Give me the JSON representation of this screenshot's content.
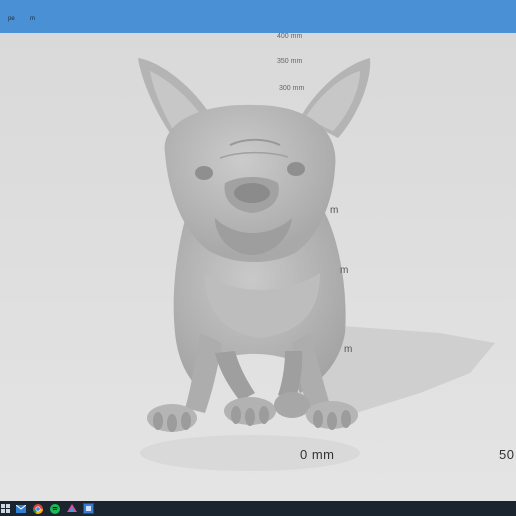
{
  "menu": {
    "items": [
      "pe",
      "m"
    ]
  },
  "viewport": {
    "ruler_far": [
      "400 mm",
      "350 mm",
      "300 mm"
    ],
    "ruler_partial": [
      "m",
      "m",
      "m"
    ],
    "ruler_origin": "0 mm",
    "ruler_right": "50"
  },
  "taskbar": {
    "icons": [
      "windows-icon",
      "mail-icon",
      "chrome-icon",
      "spotify-icon",
      "color-app-icon",
      "slicer-app-icon"
    ]
  },
  "colors": {
    "title_bar": "#4a90d4",
    "viewport_bg": "#dedede",
    "model": "#b8b8b8",
    "taskbar": "#1b2530"
  }
}
